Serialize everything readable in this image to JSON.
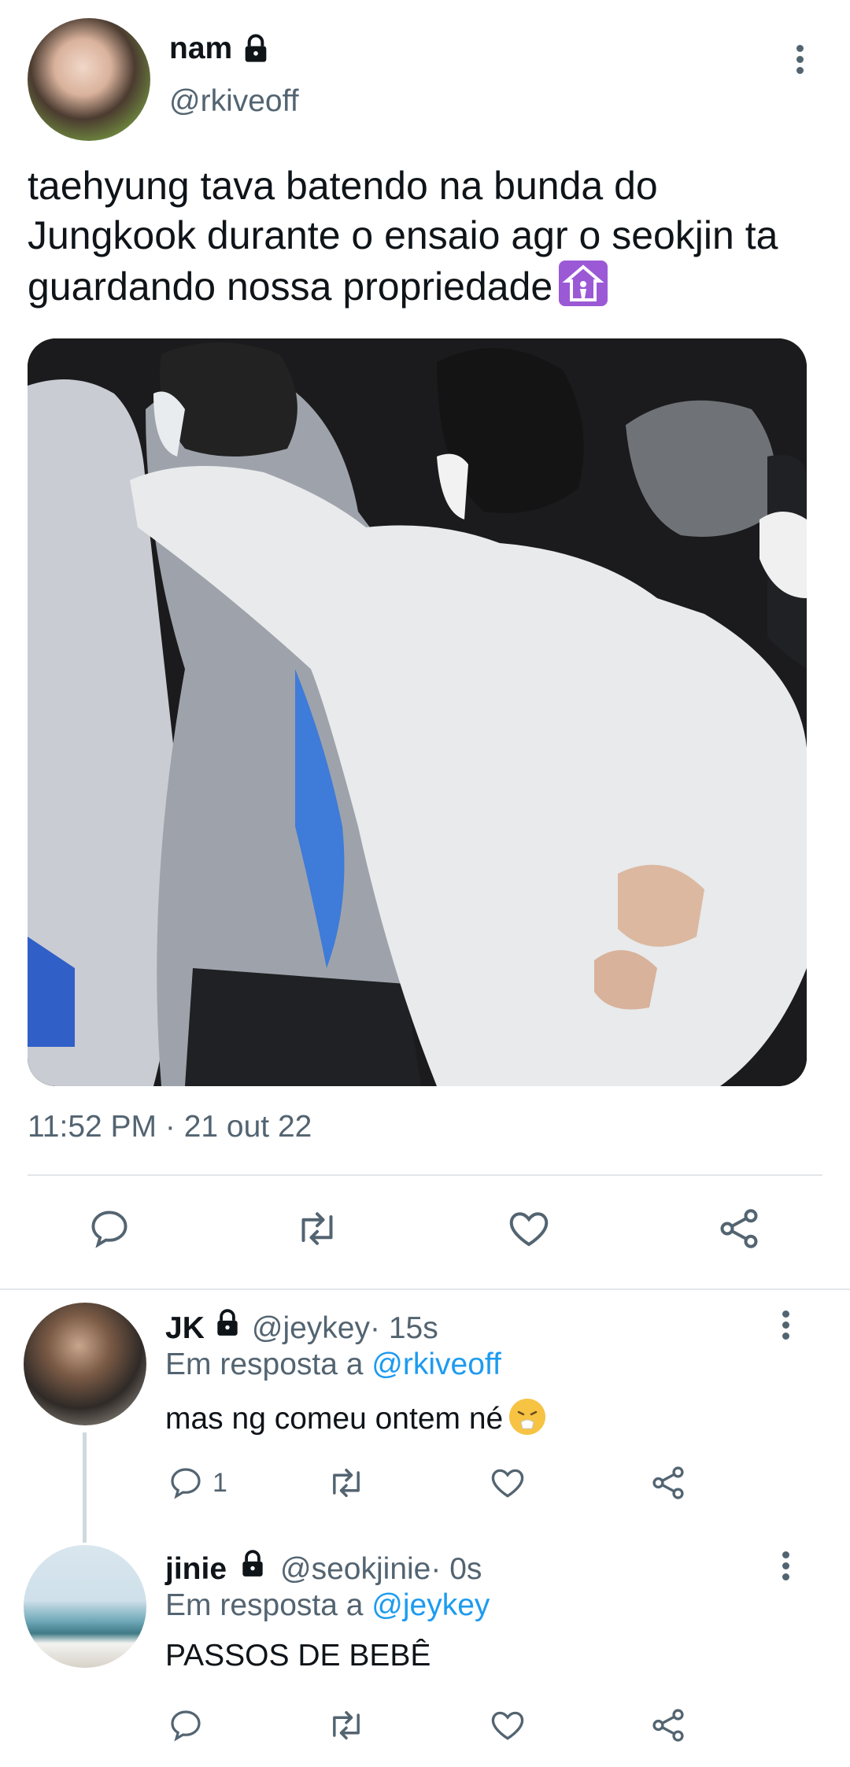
{
  "main_tweet": {
    "name": "nam",
    "handle": "@rkiveoff",
    "text": "taehyung tava batendo na bunda do Jungkook durante o ensaio agr o seokjin ta guardando nossa propriedade",
    "timestamp": "11:52 PM · 21 out 22"
  },
  "replies": [
    {
      "name": "JK",
      "handle": "@jeykey",
      "time": " · 15s",
      "reply_prefix": "Em resposta a ",
      "reply_to": "@rkiveoff",
      "text": "mas ng comeu ontem né",
      "reply_count": "1"
    },
    {
      "name": "jinie",
      "handle": "@seokjinie",
      "time": " · 0s",
      "reply_prefix": "Em resposta a ",
      "reply_to": "@jeykey",
      "text": "PASSOS DE BEBÊ"
    }
  ],
  "colors": {
    "secondary_text": "#536471",
    "link": "#1d9bf0",
    "divider": "#e3e7ea"
  },
  "icons": [
    "lock-icon",
    "more-icon",
    "reply-icon",
    "retweet-icon",
    "like-icon",
    "share-icon"
  ]
}
